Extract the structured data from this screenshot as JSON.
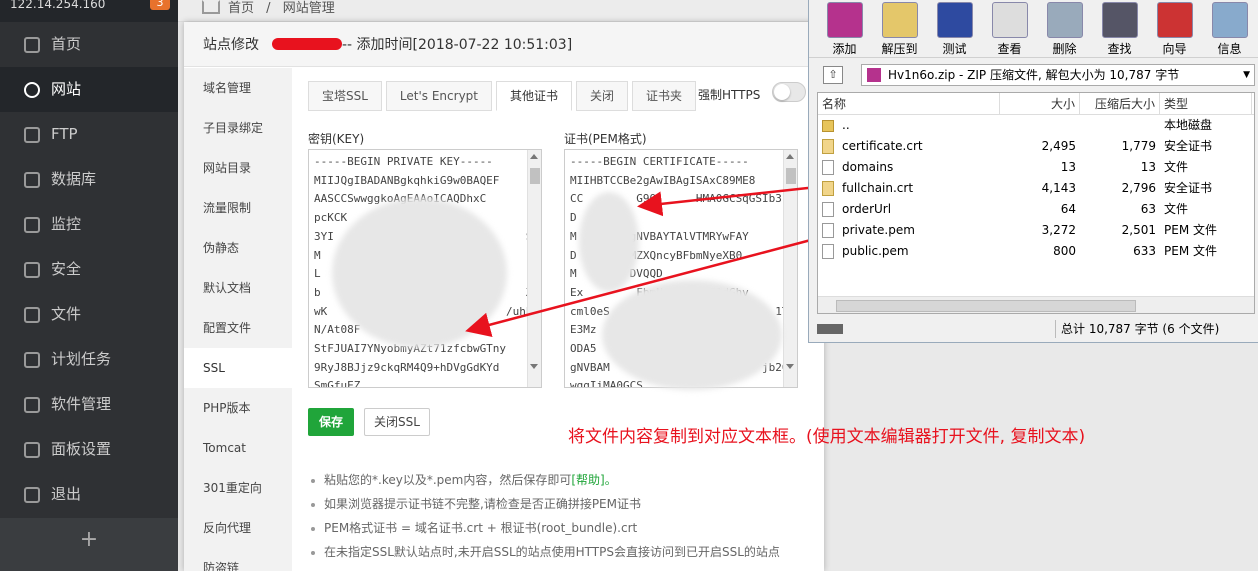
{
  "sidebar": {
    "server_ip": "122.14.254.160",
    "count": "3",
    "items": [
      {
        "label": "首页",
        "icon": "home-icon"
      },
      {
        "label": "网站",
        "icon": "globe-icon"
      },
      {
        "label": "FTP",
        "icon": "ftp-icon"
      },
      {
        "label": "数据库",
        "icon": "database-icon"
      },
      {
        "label": "监控",
        "icon": "monitor-icon"
      },
      {
        "label": "安全",
        "icon": "shield-icon"
      },
      {
        "label": "文件",
        "icon": "folder-icon"
      },
      {
        "label": "计划任务",
        "icon": "clock-icon"
      },
      {
        "label": "软件管理",
        "icon": "apps-icon"
      },
      {
        "label": "面板设置",
        "icon": "gear-icon"
      },
      {
        "label": "退出",
        "icon": "logout-icon"
      }
    ],
    "add": "+"
  },
  "breadcrumb": {
    "home": "首页",
    "sep": "/",
    "current": "网站管理"
  },
  "dialog": {
    "title_prefix": "站点修改",
    "title_suffix": "-- 添加时间[2018-07-22 10:51:03]",
    "menu": [
      "域名管理",
      "子目录绑定",
      "网站目录",
      "流量限制",
      "伪静态",
      "默认文档",
      "配置文件",
      "SSL",
      "PHP版本",
      "Tomcat",
      "301重定向",
      "反向代理",
      "防盗链"
    ],
    "tabs": [
      "宝塔SSL",
      "Let's Encrypt",
      "其他证书",
      "关闭",
      "证书夹"
    ],
    "force_https": "强制HTTPS",
    "key_label": "密钥(KEY)",
    "cert_label": "证书(PEM格式)",
    "key_text": "-----BEGIN PRIVATE KEY-----\nMIIJQgIBADANBgkqhkiG9w0BAQEF\nAASCCSwwggkoAgEAAoICAQDhxC\npcKCK\n3YI                             SfZ\nM                                u\nL\nb                               XU\nwK                           /uhbC\nN/At08F\nStFJUAI7YNyobmyAZt71zfcbwGTny\n9RyJ8BJjz9ckqRM4Q9+hDVgGdKYd\nSmGfuEZ",
    "cert_text": "-----BEGIN CERTIFICATE-----\nMIIHBTCCBe2gAwIBAgISAxC89ME8\nCC        G9Q      HMA0GCSqGSIb3\nD\nM        gNVBAYTAlVTMRYwFAY\nD        MZXQncyBFbmNyeXB0\nM        DVQQD\nEx        FbmNyeXB0IFF1dGhv\ncml0eS                         1T\nE3Mz\nODA5\ngNVBAM                       jb20\nwggIiMA0GCS",
    "save": "保存",
    "close_ssl": "关闭SSL",
    "tips": [
      {
        "text": "粘贴您的*.key以及*.pem内容，然后保存即可",
        "help": "[帮助]。"
      },
      {
        "text": "如果浏览器提示证书链不完整,请检查是否正确拼接PEM证书",
        "help": ""
      },
      {
        "text": "PEM格式证书 = 域名证书.crt + 根证书(root_bundle).crt",
        "help": ""
      },
      {
        "text": "在未指定SSL默认站点时,未开启SSL的站点使用HTTPS会直接访问到已开启SSL的站点",
        "help": ""
      }
    ]
  },
  "annotation": "将文件内容复制到对应文本框。(使用文本编辑器打开文件, 复制文本)",
  "winrar": {
    "toolbar": [
      "添加",
      "解压到",
      "测试",
      "查看",
      "删除",
      "查找",
      "向导",
      "信息"
    ],
    "up": "⇧",
    "path": "Hv1n6o.zip - ZIP 压缩文件, 解包大小为 10,787 字节",
    "columns": [
      "名称",
      "大小",
      "压缩后大小",
      "类型"
    ],
    "files": [
      {
        "name": "..",
        "size": "",
        "packed": "",
        "type": "本地磁盘",
        "kind": "folder"
      },
      {
        "name": "certificate.crt",
        "size": "2,495",
        "packed": "1,779",
        "type": "安全证书",
        "kind": "cert"
      },
      {
        "name": "domains",
        "size": "13",
        "packed": "13",
        "type": "文件",
        "kind": "file"
      },
      {
        "name": "fullchain.crt",
        "size": "4,143",
        "packed": "2,796",
        "type": "安全证书",
        "kind": "cert"
      },
      {
        "name": "orderUrl",
        "size": "64",
        "packed": "63",
        "type": "文件",
        "kind": "file"
      },
      {
        "name": "private.pem",
        "size": "3,272",
        "packed": "2,501",
        "type": "PEM 文件",
        "kind": "file"
      },
      {
        "name": "public.pem",
        "size": "800",
        "packed": "633",
        "type": "PEM 文件",
        "kind": "file"
      }
    ],
    "status": "总计 10,787 字节 (6 个文件)"
  },
  "colors": {
    "accent": "#20a53a",
    "annotation": "#e8121e",
    "sidebar": "#2f3134"
  }
}
